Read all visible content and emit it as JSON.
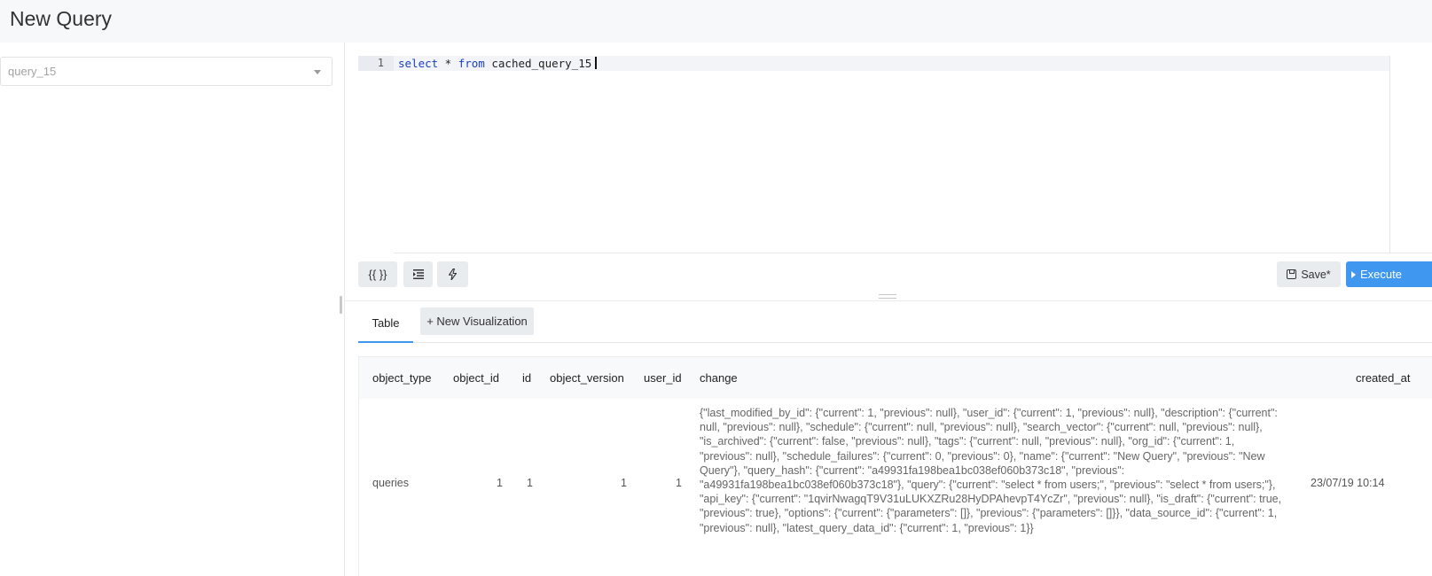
{
  "header": {
    "title": "New Query"
  },
  "schema": {
    "selected": "query_15"
  },
  "editor": {
    "line_number": "1",
    "tokens": {
      "kw1": "select",
      "star": " * ",
      "kw2": "from",
      "table": " cached_query_15"
    }
  },
  "toolbar": {
    "params_label": "{{ }}",
    "save_label": "Save*",
    "execute_label": "Execute"
  },
  "tabs": {
    "table_label": "Table",
    "new_vis_label": "+ New Visualization"
  },
  "results": {
    "columns": [
      "object_type",
      "object_id",
      "id",
      "object_version",
      "user_id",
      "change",
      "created_at"
    ],
    "rows": [
      {
        "object_type": "queries",
        "object_id": "1",
        "id": "1",
        "object_version": "1",
        "user_id": "1",
        "change": "{\"last_modified_by_id\": {\"current\": 1, \"previous\": null}, \"user_id\": {\"current\": 1, \"previous\": null}, \"description\": {\"current\": null, \"previous\": null}, \"schedule\": {\"current\": null, \"previous\": null}, \"search_vector\": {\"current\": null, \"previous\": null}, \"is_archived\": {\"current\": false, \"previous\": null}, \"tags\": {\"current\": null, \"previous\": null}, \"org_id\": {\"current\": 1, \"previous\": null}, \"schedule_failures\": {\"current\": 0, \"previous\": 0}, \"name\": {\"current\": \"New Query\", \"previous\": \"New Query\"}, \"query_hash\": {\"current\": \"a49931fa198bea1bc038ef060b373c18\", \"previous\": \"a49931fa198bea1bc038ef060b373c18\"}, \"query\": {\"current\": \"select * from users;\", \"previous\": \"select * from users;\"}, \"api_key\": {\"current\": \"1qvirNwagqT9V31uLUKXZRu28HyDPAhevpT4YcZr\", \"previous\": null}, \"is_draft\": {\"current\": true, \"previous\": true}, \"options\": {\"current\": {\"parameters\": []}, \"previous\": {\"parameters\": []}}, \"data_source_id\": {\"current\": 1, \"previous\": null}, \"latest_query_data_id\": {\"current\": 1, \"previous\": 1}}",
        "created_at": "23/07/19 10:14"
      }
    ]
  },
  "colors": {
    "accent": "#3f97f0",
    "keyword": "#1a3fbf"
  }
}
